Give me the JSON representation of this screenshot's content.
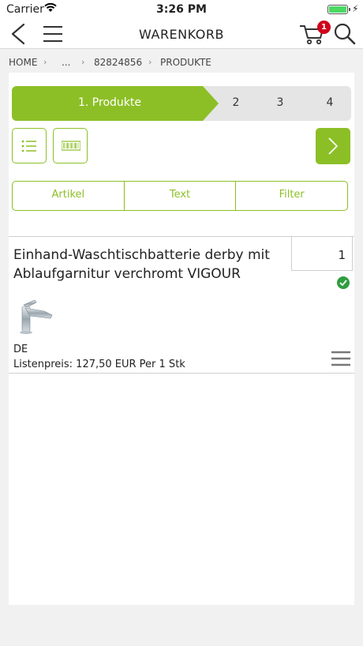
{
  "status": {
    "carrier": "Carrier",
    "time": "3:26 PM"
  },
  "nav": {
    "title": "WARENKORB",
    "cart_count": "1"
  },
  "breadcrumb": {
    "items": [
      "HOME",
      "...",
      "82824856",
      "PRODUKTE"
    ],
    "separator": "›"
  },
  "steps": {
    "active_label": "1. Produkte",
    "others": [
      "2",
      "3",
      "4"
    ]
  },
  "tabs": [
    "Artikel",
    "Text",
    "Filter"
  ],
  "item": {
    "name": "Einhand-Waschtischbatterie derby mit Ablaufgarnitur verchromt VIGOUR",
    "quantity": "1",
    "country": "DE",
    "price": "Listenpreis: 127,50 EUR Per 1 Stk"
  },
  "colors": {
    "accent": "#8cbf26",
    "badge": "#d0021b",
    "check": "#2e9e3f"
  }
}
